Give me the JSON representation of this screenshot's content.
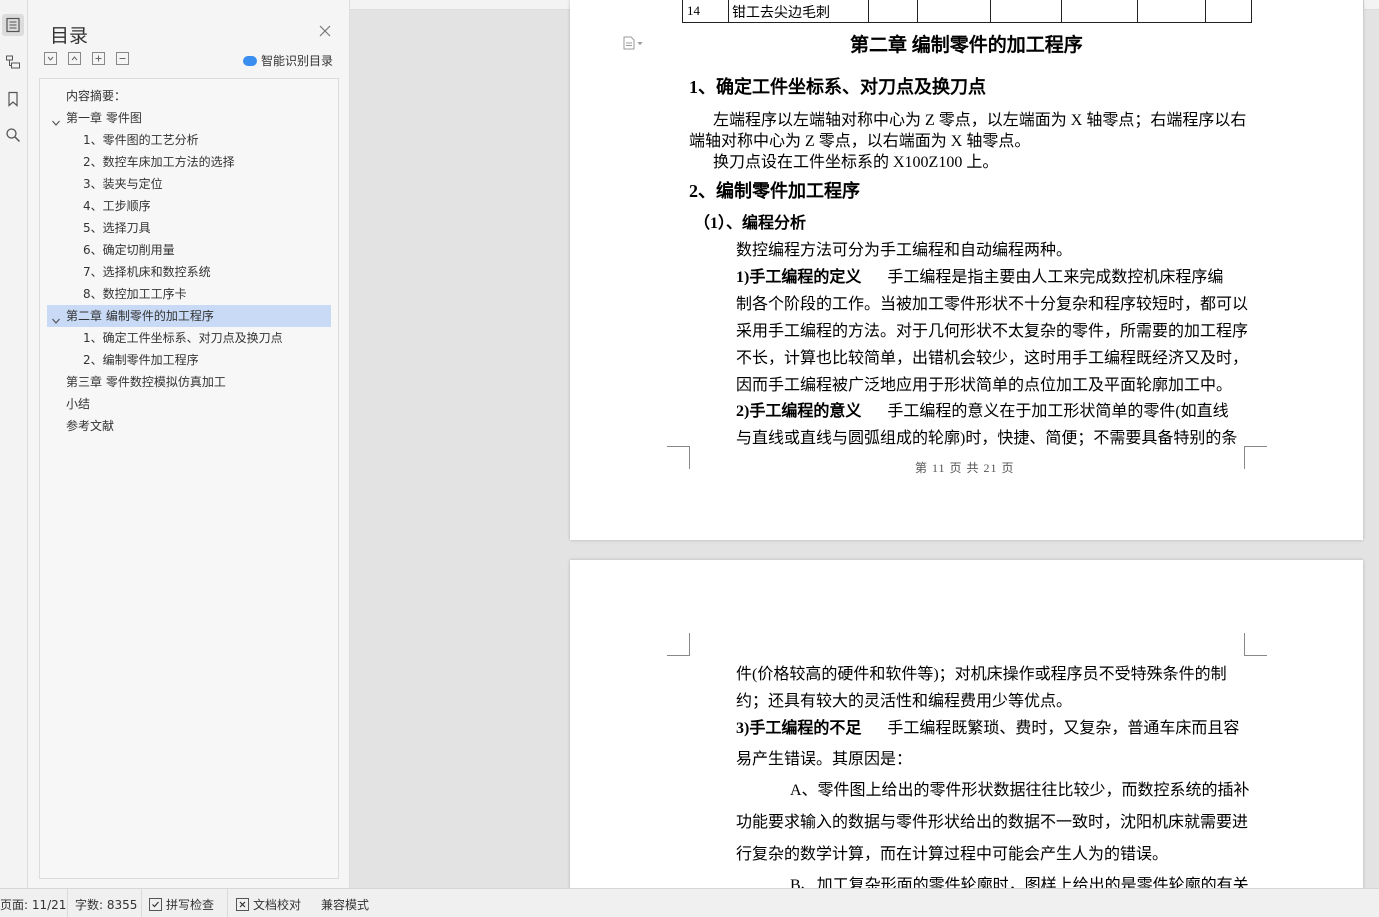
{
  "sidebar": {
    "toc_title": "目录",
    "smart_label": "智能识别目录",
    "items": [
      {
        "label": "内容摘要："
      },
      {
        "label": "第一章 零件图"
      },
      {
        "label": "1、零件图的工艺分析"
      },
      {
        "label": "2、数控车床加工方法的选择"
      },
      {
        "label": "3、装夹与定位"
      },
      {
        "label": "4、工步顺序"
      },
      {
        "label": "5、选择刀具"
      },
      {
        "label": "6、确定切削用量"
      },
      {
        "label": "7、选择机床和数控系统"
      },
      {
        "label": "8、数控加工工序卡"
      },
      {
        "label": "第二章 编制零件的加工程序"
      },
      {
        "label": "1、确定工件坐标系、对刀点及换刀点"
      },
      {
        "label": "2、编制零件加工程序"
      },
      {
        "label": "第三章 零件数控模拟仿真加工"
      },
      {
        "label": "小结"
      },
      {
        "label": "参考文献"
      }
    ],
    "selected_index": 10
  },
  "page1": {
    "table_row": {
      "num": "14",
      "text": "钳工去尖边毛刺"
    },
    "chapter_title": "第二章  编制零件的加工程序",
    "sec1_title": "1、确定工件坐标系、对刀点及换刀点",
    "sec1_p1_line1": "左端程序以左端轴对称中心为 Z 零点，以左端面为 X 轴零点；右端程序以右",
    "sec1_p1_line2": "端轴对称中心为 Z 零点，以右端面为 X 轴零点。",
    "sec1_p2": "换刀点设在工件坐标系的 X100Z100 上。",
    "sec2_title": "2、编制零件加工程序",
    "sub1_title": "（1）、编程分析",
    "sub1_intro": "数控编程方法可分为手工编程和自动编程两种。",
    "def_label": "1)手工编程的定义",
    "def_line1": "手工编程是指主要由人工来完成数控机床程序编",
    "def_line2": "制各个阶段的工作。当被加工零件形状不十分复杂和程序较短时，都可以",
    "def_line3": "采用手工编程的方法。对于几何形状不太复杂的零件，所需要的加工程序",
    "def_line4": "不长，计算也比较简单，出错机会较少，这时用手工编程既经济又及时，",
    "def_line5": "因而手工编程被广泛地应用于形状简单的点位加工及平面轮廓加工中。",
    "mean_label": "2)手工编程的意义",
    "mean_line1": "手工编程的意义在于加工形状简单的零件(如直线",
    "mean_line2": "与直线或直线与圆弧组成的轮廓)时，快捷、简便；不需要具备特别的条",
    "footer": "第 11 页 共 21 页"
  },
  "page2": {
    "line1": "件(价格较高的硬件和软件等)；对机床操作或程序员不受特殊条件的制",
    "line2": "约；还具有较大的灵活性和编程费用少等优点。",
    "short_label": "3)手工编程的不足",
    "short_line1": "手工编程既繁琐、费时，又复杂，普通车床而且容",
    "short_line2": "易产生错误。其原因是：",
    "a_line1": "A、零件图上给出的零件形状数据往往比较少，而数控系统的插补",
    "a_line2": "功能要求输入的数据与零件形状给出的数据不一致时，沈阳机床就需要进",
    "a_line3": "行复杂的数学计算，而在计算过程中可能会产生人为的错误。",
    "b_line1": "B、加工复杂形面的零件轮廓时，图样上给出的是零件轮廓的有关"
  },
  "statusbar": {
    "page": "页面: 11/21",
    "words": "字数: 8355",
    "spell": "拼写检查",
    "proof": "文档校对",
    "compat": "兼容模式"
  }
}
